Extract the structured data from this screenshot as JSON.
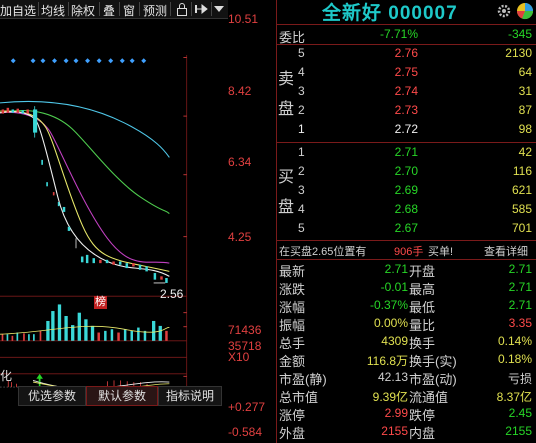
{
  "toolbar": {
    "items": [
      "加自选",
      "均线",
      "除权",
      "叠",
      "窗",
      "预测"
    ],
    "lock_icon": "lock-icon",
    "pin_icon": "pin-icon",
    "dropdown_icon": "chevron-down-icon"
  },
  "chart": {
    "price_ticks": [
      "10.51",
      "8.42",
      "6.34",
      "4.25"
    ],
    "volume_ticks": [
      "71436",
      "35718"
    ],
    "volume_unit": "X10",
    "macd_ticks": [
      "+0.277",
      "-0.584"
    ],
    "low_marker": "2.56",
    "rank_badge": "榜",
    "indicator_fragment": "化",
    "tabs": [
      "优选参数",
      "默认参数",
      "指标说明"
    ]
  },
  "quote": {
    "title": "全新好 000007",
    "webi": {
      "label": "委比",
      "pct": "-7.71%",
      "diff": "-345"
    },
    "sell": {
      "label_top": "卖",
      "label_bottom": "盘",
      "rows": [
        {
          "lvl": "5",
          "price": "2.76",
          "vol": "2130"
        },
        {
          "lvl": "4",
          "price": "2.75",
          "vol": "64"
        },
        {
          "lvl": "3",
          "price": "2.74",
          "vol": "31"
        },
        {
          "lvl": "2",
          "price": "2.73",
          "vol": "87"
        },
        {
          "lvl": "1",
          "price": "2.72",
          "vol": "98"
        }
      ]
    },
    "buy": {
      "label_top": "买",
      "label_bottom": "盘",
      "rows": [
        {
          "lvl": "1",
          "price": "2.71",
          "vol": "42"
        },
        {
          "lvl": "2",
          "price": "2.70",
          "vol": "116"
        },
        {
          "lvl": "3",
          "price": "2.69",
          "vol": "621"
        },
        {
          "lvl": "4",
          "price": "2.68",
          "vol": "585"
        },
        {
          "lvl": "5",
          "price": "2.67",
          "vol": "701"
        }
      ]
    },
    "notice": {
      "text": "在买盘2.65位置有",
      "amount": "906手",
      "action": "买单!",
      "link": "查看详细"
    },
    "stats": [
      {
        "l1": "最新",
        "v1": "2.71",
        "c1": "grn",
        "l2": "开盘",
        "v2": "2.71",
        "c2": "grn"
      },
      {
        "l1": "涨跌",
        "v1": "-0.01",
        "c1": "grn",
        "l2": "最高",
        "v2": "2.71",
        "c2": "grn"
      },
      {
        "l1": "涨幅",
        "v1": "-0.37%",
        "c1": "grn",
        "l2": "最低",
        "v2": "2.71",
        "c2": "grn"
      },
      {
        "l1": "振幅",
        "v1": "0.00%",
        "c1": "yel",
        "l2": "量比",
        "v2": "3.35",
        "c2": "red"
      },
      {
        "l1": "总手",
        "v1": "4309",
        "c1": "yel",
        "l2": "换手",
        "v2": "0.14%",
        "c2": "yel"
      },
      {
        "l1": "金额",
        "v1": "116.8万",
        "c1": "yel",
        "l2": "换手(实)",
        "v2": "0.18%",
        "c2": "yel"
      },
      {
        "l1": "市盈(静)",
        "v1": "42.13",
        "c1": "hl",
        "l2": "市盈(动)",
        "v2": "亏损",
        "c2": "hl"
      },
      {
        "l1": "总市值",
        "v1": "9.39亿",
        "c1": "yel",
        "l2": "流通值",
        "v2": "8.37亿",
        "c2": "yel"
      },
      {
        "l1": "涨停",
        "v1": "2.99",
        "c1": "red",
        "l2": "跌停",
        "v2": "2.45",
        "c2": "grn"
      },
      {
        "l1": "外盘",
        "v1": "2155",
        "c1": "red",
        "l2": "内盘",
        "v2": "2155",
        "c2": "grn"
      }
    ]
  }
}
